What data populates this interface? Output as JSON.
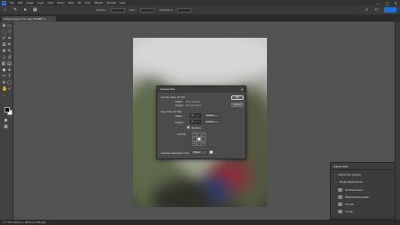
{
  "app": {
    "logo": "Ps",
    "menu": [
      "File",
      "Edit",
      "Image",
      "Layer",
      "Type",
      "Select",
      "Filter",
      "3D",
      "View",
      "Plugins",
      "Window",
      "Help"
    ],
    "window_controls": [
      "—",
      "▢",
      "✕"
    ]
  },
  "options_bar": {
    "opacity_label": "Opacity:",
    "flow_label": "Flow:",
    "smoothing_label": "Smoothing:"
  },
  "document_tab": {
    "title": "Artist's song in (72 copy, RGB/8*) ×"
  },
  "canvas_size_dialog": {
    "title": "Canvas Size",
    "current_size_label": "Current Size: 67.3M",
    "current_width_label": "Width:",
    "current_width_value": "8.37 Inches",
    "current_height_label": "Height:",
    "current_height_value": "10.13 Inches",
    "new_size_label": "New Size: 67.3M",
    "width_label": "Width:",
    "width_value": "0",
    "height_label": "Height:",
    "height_value": "0",
    "unit": "Inches",
    "relative_label": "Relative",
    "relative_checked": true,
    "anchor_label": "Anchor:",
    "anchor_arrows": [
      "↖",
      "↑",
      "↗",
      "←",
      "",
      "→",
      "↙",
      "↓",
      "↘"
    ],
    "extension_label": "Canvas extension color:",
    "extension_value": "Other",
    "ok_label": "OK",
    "cancel_label": "Cancel"
  },
  "adjustments_panel": {
    "title": "Adjustments",
    "items": [
      "Adjustment presets",
      "Single Adjustments",
      "Hue/Saturation",
      "Brightness/Contrast",
      "Curves",
      "Levels"
    ]
  },
  "status": {
    "text": "17.73%   2100 px x 2511 px (300 ppi)"
  },
  "colors": {
    "accent": "#1473e6",
    "foreground_color": "#000000",
    "background_color": "#ffffff"
  }
}
